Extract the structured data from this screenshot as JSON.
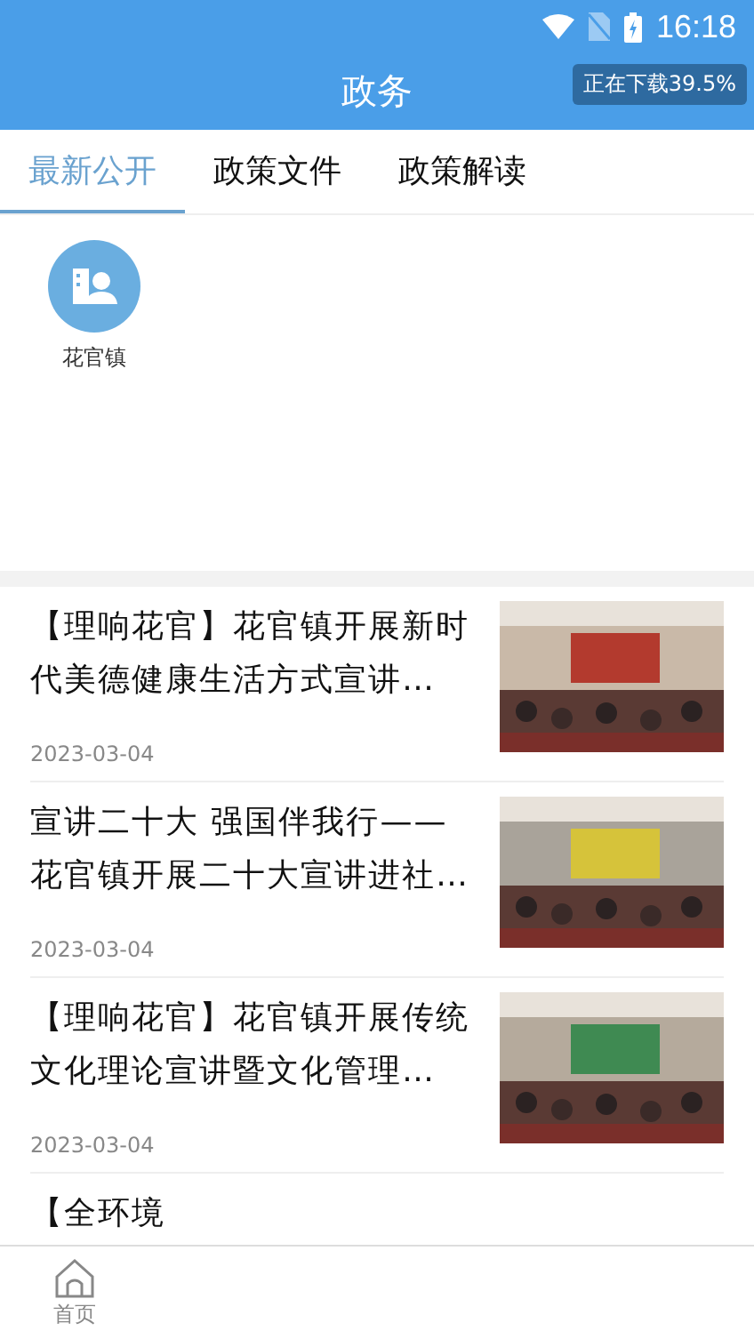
{
  "status_bar": {
    "time": "16:18"
  },
  "header": {
    "title": "政务",
    "download_badge": "正在下载39.5%"
  },
  "tabs": [
    {
      "label": "最新公开",
      "selected": true
    },
    {
      "label": "政策文件",
      "selected": false
    },
    {
      "label": "政策解读",
      "selected": false
    }
  ],
  "categories": [
    {
      "label": "花官镇"
    }
  ],
  "news": [
    {
      "title": "【理响花官】花官镇开展新时代美德健康生活方式宣讲…",
      "date": "2023-03-04"
    },
    {
      "title": "宣讲二十大 强国伴我行——花官镇开展二十大宣讲进社…",
      "date": "2023-03-04"
    },
    {
      "title": "【理响花官】花官镇开展传统文化理论宣讲暨文化管理…",
      "date": "2023-03-04"
    },
    {
      "title": "【全环境"
    }
  ],
  "bottom_nav": [
    {
      "label": "首页",
      "selected": true
    }
  ]
}
